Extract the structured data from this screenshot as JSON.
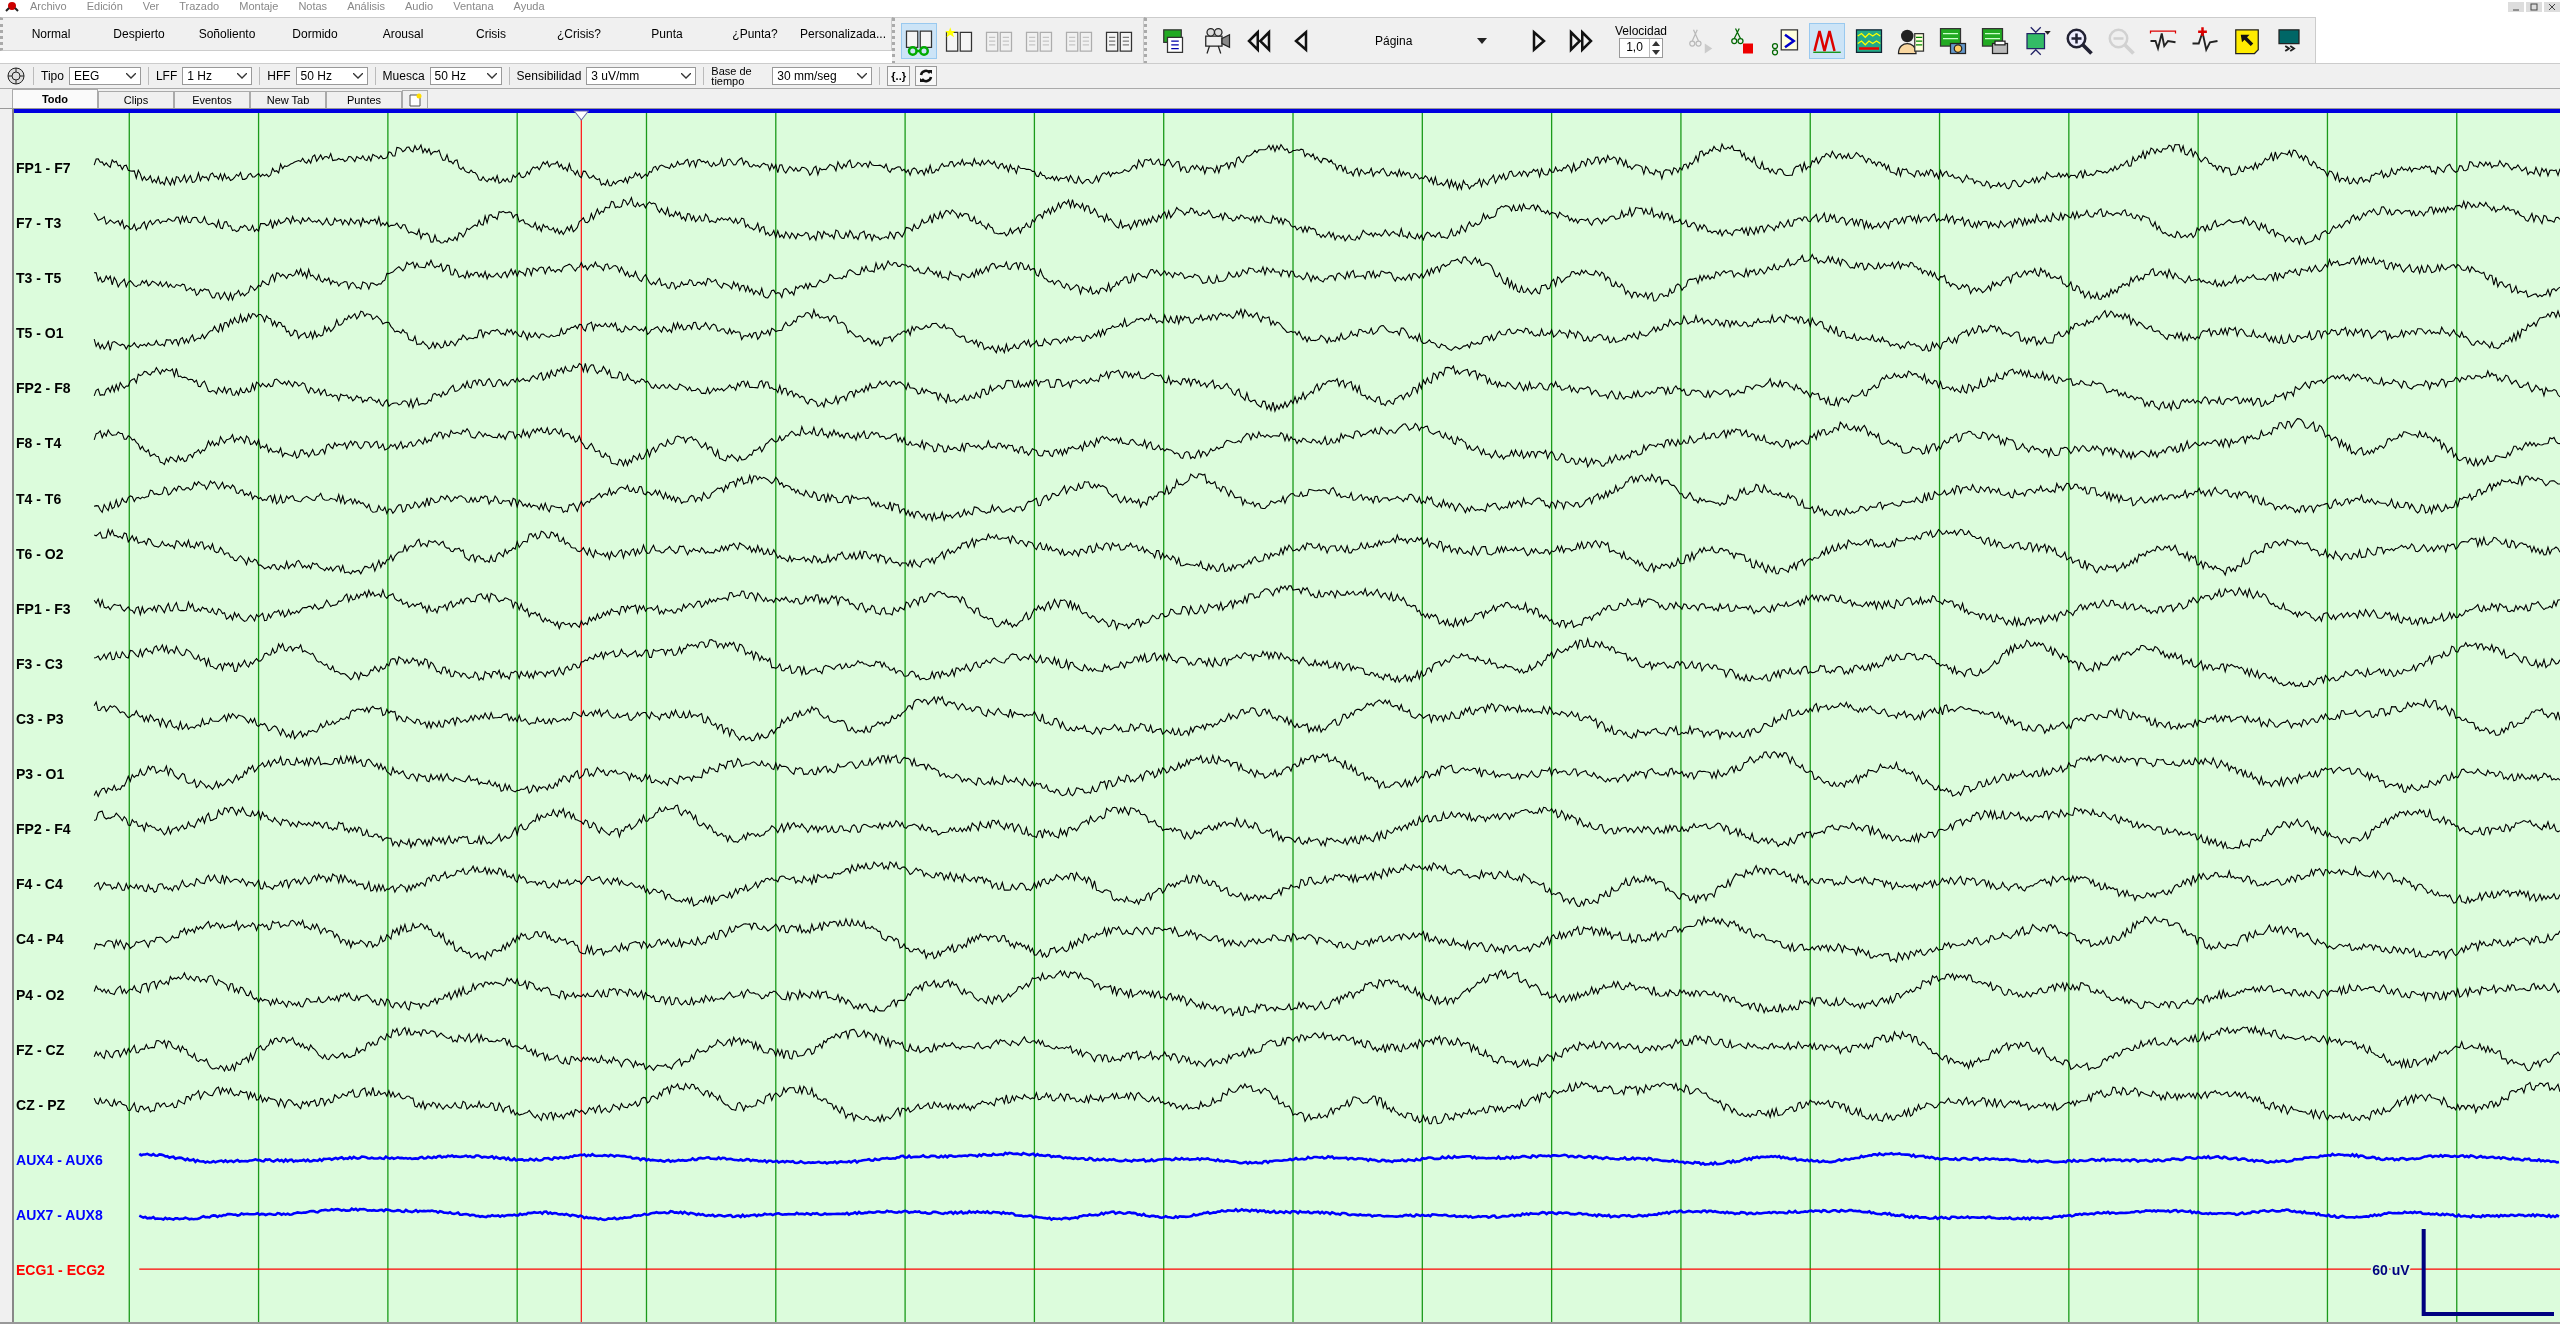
{
  "menu": [
    "Archivo",
    "Edición",
    "Ver",
    "Trazado",
    "Montaje",
    "Notas",
    "Análisis",
    "Audio",
    "Ventana",
    "Ayuda"
  ],
  "event_buttons": [
    "Normal",
    "Despierto",
    "Soñoliento",
    "Dormido",
    "Arousal",
    "Crisis",
    "¿Crisis?",
    "Punta",
    "¿Punta?",
    "Personalizada..."
  ],
  "view_tools": [
    {
      "kind": "book-glasses",
      "pressed": true,
      "disabled": false
    },
    {
      "kind": "book-star",
      "pressed": false,
      "disabled": false
    },
    {
      "kind": "book",
      "pressed": false,
      "disabled": true
    },
    {
      "kind": "book",
      "pressed": false,
      "disabled": true
    },
    {
      "kind": "book",
      "pressed": false,
      "disabled": true
    },
    {
      "kind": "book",
      "pressed": false,
      "disabled": false
    }
  ],
  "nav_tools": [
    {
      "kind": "sheets",
      "pressed": false,
      "disabled": false
    },
    {
      "kind": "video-camera",
      "pressed": false,
      "disabled": false
    },
    {
      "kind": "rewind",
      "pressed": false,
      "disabled": false
    },
    {
      "kind": "step-back",
      "pressed": false,
      "disabled": false
    },
    {
      "kind": "page",
      "label": "Página"
    },
    {
      "kind": "step-forward",
      "pressed": false,
      "disabled": false
    },
    {
      "kind": "fast-forward",
      "pressed": false,
      "disabled": false
    },
    {
      "kind": "speed",
      "label": "Velocidad",
      "value": "1,0"
    },
    {
      "kind": "scissors-play",
      "pressed": false,
      "disabled": true
    },
    {
      "kind": "scissors-stop",
      "pressed": false,
      "disabled": false
    },
    {
      "kind": "scissors-sheet",
      "pressed": false,
      "disabled": false
    },
    {
      "kind": "peaks",
      "pressed": true,
      "disabled": false
    },
    {
      "kind": "waveform-grid",
      "pressed": false,
      "disabled": false
    },
    {
      "kind": "person-sheet",
      "pressed": false,
      "disabled": false
    },
    {
      "kind": "sheet-camera",
      "pressed": false,
      "disabled": false
    },
    {
      "kind": "sheet-printer",
      "pressed": false,
      "disabled": false
    },
    {
      "kind": "expand-sheet",
      "pressed": false,
      "disabled": false
    },
    {
      "kind": "zoom-in",
      "pressed": false,
      "disabled": false
    },
    {
      "kind": "zoom-out",
      "pressed": false,
      "disabled": true
    },
    {
      "kind": "waveform-bracket",
      "pressed": false,
      "disabled": false
    },
    {
      "kind": "waveform-plus",
      "pressed": false,
      "disabled": false
    },
    {
      "kind": "note-arrow",
      "pressed": false,
      "disabled": false
    },
    {
      "kind": "monitor",
      "pressed": false,
      "disabled": false
    }
  ],
  "filters": [
    {
      "label": "Tipo",
      "value": "EEG"
    },
    {
      "label": "LFF",
      "value": "1 Hz"
    },
    {
      "label": "HFF",
      "value": "50 Hz"
    },
    {
      "label": "Muesca",
      "value": "50 Hz"
    },
    {
      "label": "Sensibilidad",
      "value": "3 uV/mm"
    },
    {
      "label": "Base de tiempo",
      "value": "30 mm/seg"
    }
  ],
  "filter_buttons": [
    "{..}"
  ],
  "tabs": [
    {
      "label": "Todo",
      "selected": true
    },
    {
      "label": "Clips",
      "selected": false
    },
    {
      "label": "Eventos",
      "selected": false
    },
    {
      "label": "New Tab",
      "selected": false
    },
    {
      "label": "Puntes",
      "selected": false
    }
  ],
  "channels": [
    {
      "name": "FP1 - F7",
      "kind": "eeg",
      "color": "#000000"
    },
    {
      "name": "F7 - T3",
      "kind": "eeg",
      "color": "#000000"
    },
    {
      "name": "T3 - T5",
      "kind": "eeg",
      "color": "#000000"
    },
    {
      "name": "T5 - O1",
      "kind": "eeg",
      "color": "#000000"
    },
    {
      "name": "FP2 - F8",
      "kind": "eeg",
      "color": "#000000"
    },
    {
      "name": "F8 - T4",
      "kind": "eeg",
      "color": "#000000"
    },
    {
      "name": "T4 - T6",
      "kind": "eeg",
      "color": "#000000"
    },
    {
      "name": "T6 - O2",
      "kind": "eeg",
      "color": "#000000"
    },
    {
      "name": "FP1 - F3",
      "kind": "eeg",
      "color": "#000000"
    },
    {
      "name": "F3 - C3",
      "kind": "eeg",
      "color": "#000000"
    },
    {
      "name": "C3 - P3",
      "kind": "eeg",
      "color": "#000000"
    },
    {
      "name": "P3 - O1",
      "kind": "eeg",
      "color": "#000000"
    },
    {
      "name": "FP2 - F4",
      "kind": "eeg",
      "color": "#000000"
    },
    {
      "name": "F4 - C4",
      "kind": "eeg",
      "color": "#000000"
    },
    {
      "name": "C4 - P4",
      "kind": "eeg",
      "color": "#000000"
    },
    {
      "name": "P4 - O2",
      "kind": "eeg",
      "color": "#000000"
    },
    {
      "name": "FZ - CZ",
      "kind": "eeg",
      "color": "#000000"
    },
    {
      "name": "CZ - PZ",
      "kind": "eeg",
      "color": "#000000"
    },
    {
      "name": "AUX4 - AUX6",
      "kind": "aux",
      "color": "#0000ff"
    },
    {
      "name": "AUX7 - AUX8",
      "kind": "aux",
      "color": "#0000ff"
    },
    {
      "name": "ECG1 - ECG2",
      "kind": "ecg",
      "color": "#ff0000"
    }
  ],
  "scale_label": "60 uV"
}
